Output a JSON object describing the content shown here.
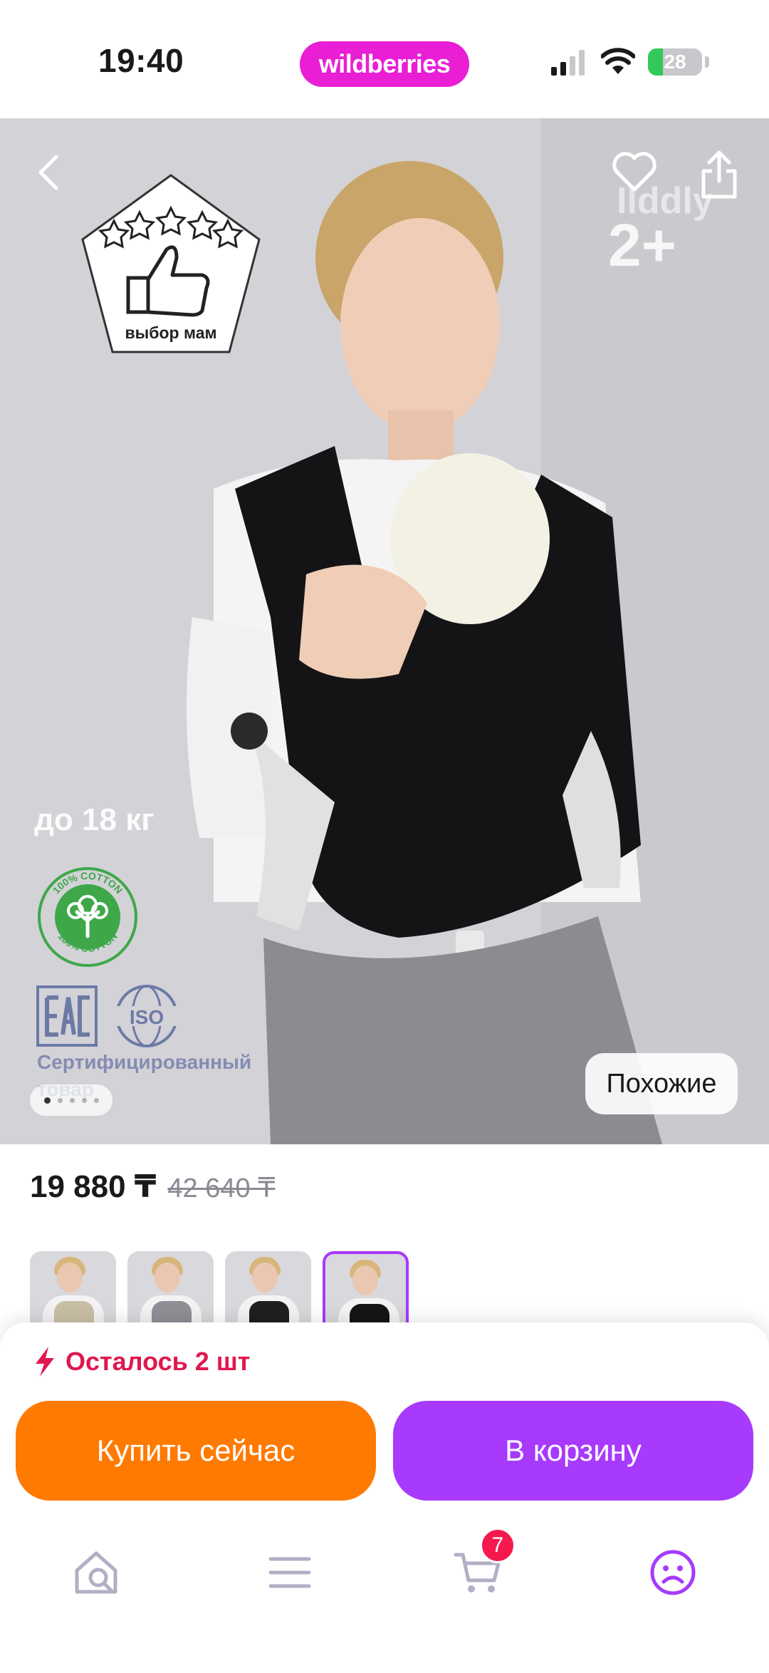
{
  "status_bar": {
    "time": "19:40",
    "brand": "wildberries",
    "battery_percent": 28,
    "battery_label": "28"
  },
  "hero": {
    "brand_mark": "Ilddly",
    "age_badge": "2+",
    "mom_badge_label": "выбор мам",
    "weight_label": "до 18 кг",
    "cotton_badge_text": "100% COTTON",
    "certified_label": "Сертифицированный товар",
    "similar_button": "Похожие",
    "image_index": 1,
    "image_count": 5
  },
  "price": {
    "current": "19 880 ₸",
    "old": "42 640 ₸"
  },
  "thumbnails": [
    {
      "carrier_color": "#c9bfa6",
      "selected": false
    },
    {
      "carrier_color": "#8f9096",
      "selected": false
    },
    {
      "carrier_color": "#1f1f22",
      "selected": false
    },
    {
      "carrier_color": "#151517",
      "selected": true
    }
  ],
  "sheet": {
    "stock_text": "Осталось 2 шт",
    "buy_now": "Купить сейчас",
    "to_cart": "В корзину"
  },
  "tabbar": {
    "cart_count": "7",
    "icons": [
      "home-search-icon",
      "menu-icon",
      "cart-icon",
      "profile-icon"
    ]
  },
  "colors": {
    "brand": "#e91ed5",
    "accent_purple": "#a73afd",
    "accent_orange": "#ff7a00",
    "alert_red": "#e0184f"
  }
}
